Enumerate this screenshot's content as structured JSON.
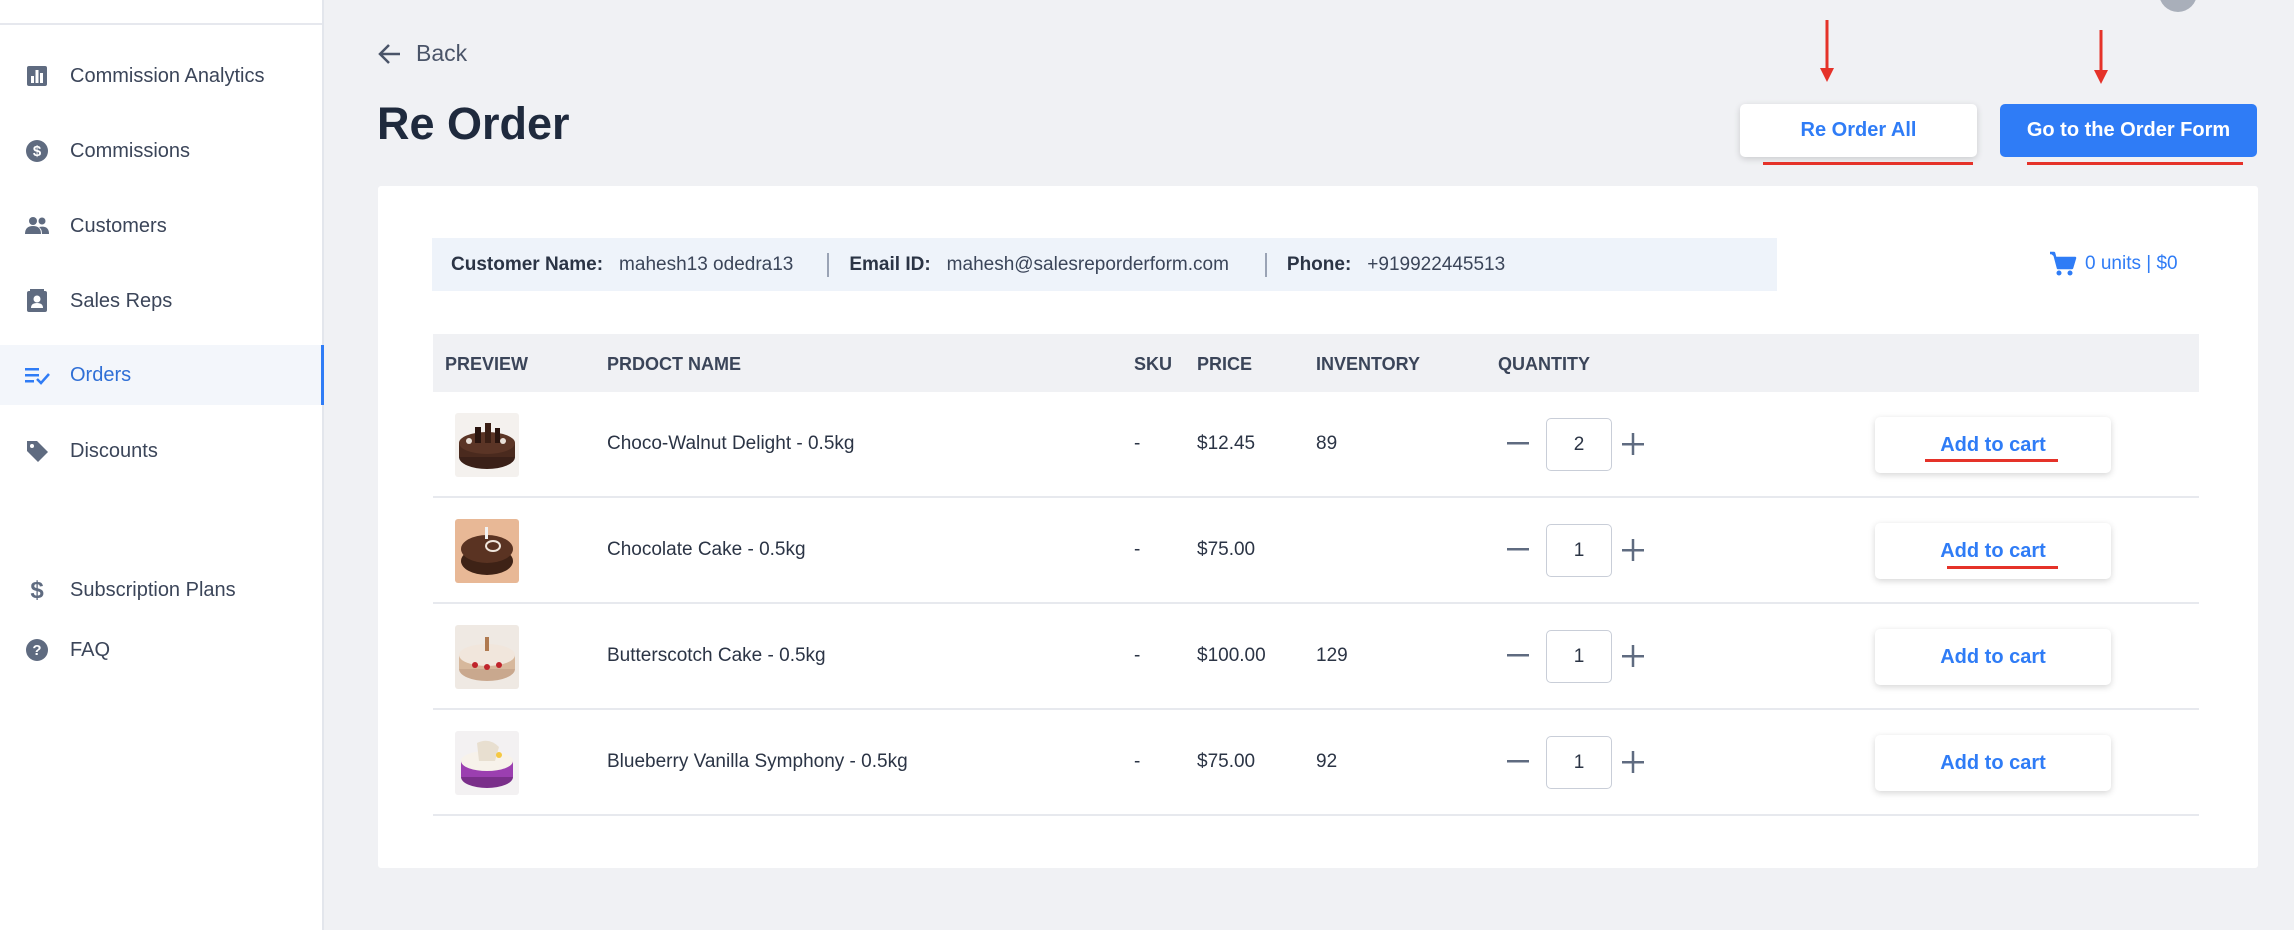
{
  "sidebar": {
    "items": [
      {
        "label": "Commission Analytics",
        "icon": "bar-chart-icon"
      },
      {
        "label": "Commissions",
        "icon": "dollar-circle-icon"
      },
      {
        "label": "Customers",
        "icon": "people-icon"
      },
      {
        "label": "Sales Reps",
        "icon": "contact-card-icon"
      },
      {
        "label": "Orders",
        "icon": "list-check-icon",
        "active": true
      },
      {
        "label": "Discounts",
        "icon": "tag-icon"
      },
      {
        "label": "Subscription Plans",
        "icon": "dollar-icon"
      },
      {
        "label": "FAQ",
        "icon": "help-circle-icon"
      }
    ]
  },
  "page": {
    "back_label": "Back",
    "title": "Re Order",
    "reorder_all_label": "Re Order All",
    "order_form_label": "Go to the Order Form"
  },
  "info": {
    "customer_label": "Customer Name:",
    "customer_value": "mahesh13 odedra13",
    "email_label": "Email ID:",
    "email_value": "mahesh@salesreporderform.com",
    "phone_label": "Phone:",
    "phone_value": "+919922445513"
  },
  "cart": {
    "summary": "0 units | $0"
  },
  "table": {
    "headers": {
      "preview": "PREVIEW",
      "name": "PRDOCT NAME",
      "sku": "SKU",
      "price": "PRICE",
      "inventory": "INVENTORY",
      "quantity": "QUANTITY"
    },
    "rows": [
      {
        "name": "Choco-Walnut Delight - 0.5kg",
        "sku": "-",
        "price": "$12.45",
        "inventory": "89",
        "quantity": "2",
        "action": "Add to cart"
      },
      {
        "name": "Chocolate Cake - 0.5kg",
        "sku": "-",
        "price": "$75.00",
        "inventory": "",
        "quantity": "1",
        "action": "Add to cart"
      },
      {
        "name": "Butterscotch Cake - 0.5kg",
        "sku": "-",
        "price": "$100.00",
        "inventory": "129",
        "quantity": "1",
        "action": "Add to cart"
      },
      {
        "name": "Blueberry Vanilla Symphony - 0.5kg",
        "sku": "-",
        "price": "$75.00",
        "inventory": "92",
        "quantity": "1",
        "action": "Add to cart"
      }
    ]
  },
  "colors": {
    "accent": "#2f7cf6",
    "annotation": "#e53229"
  }
}
